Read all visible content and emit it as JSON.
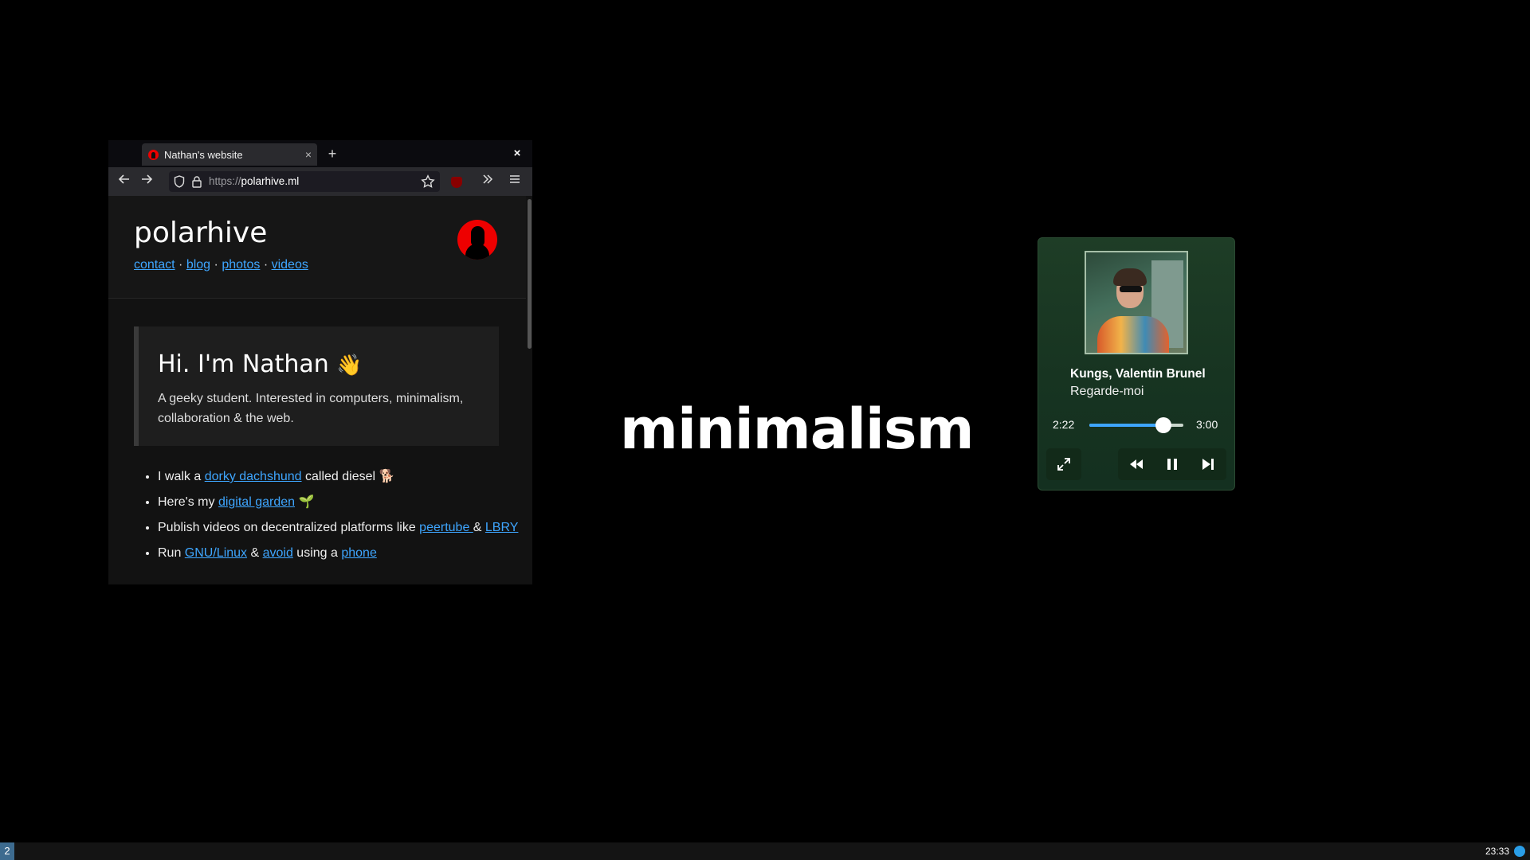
{
  "browser": {
    "tab_title": "Nathan's website",
    "tab_close": "×",
    "new_tab": "+",
    "window_close": "×",
    "url_protocol": "https://",
    "url_host": "polarhive.ml"
  },
  "site": {
    "title": "polarhive",
    "nav": [
      {
        "label": "contact"
      },
      {
        "label": "blog"
      },
      {
        "label": "photos"
      },
      {
        "label": "videos"
      }
    ],
    "nav_separator": "·",
    "hero_title": "Hi. I'm Nathan",
    "hero_emoji": "👋",
    "hero_text": "A geeky student. Interested in computers, minimalism, collaboration & the web.",
    "bullets": {
      "b1_pre": "I walk a ",
      "b1_link": "dorky dachshund",
      "b1_post": " called diesel 🐕",
      "b2_pre": "Here's my ",
      "b2_link": "digital garden",
      "b2_post": " 🌱",
      "b3_pre": "Publish videos on decentralized platforms like ",
      "b3_link1": "peertube ",
      "b3_mid": "& ",
      "b3_link2": "LBRY",
      "b4_pre": "Run ",
      "b4_link1": "GNU/Linux",
      "b4_mid1": " & ",
      "b4_link2": "avoid",
      "b4_mid2": " using a ",
      "b4_link3": "phone"
    }
  },
  "desktop": {
    "center_text": "minimalism"
  },
  "player": {
    "artist": "Kungs, Valentin Brunel",
    "song": "Regarde-moi",
    "current_time": "2:22",
    "duration": "3:00",
    "progress": 0.789
  },
  "taskbar": {
    "workspace": "2",
    "clock": "23:33"
  },
  "colors": {
    "link": "#3ea6ff",
    "player_bg": "#1e3d26",
    "logo_red": "#ee0000"
  }
}
